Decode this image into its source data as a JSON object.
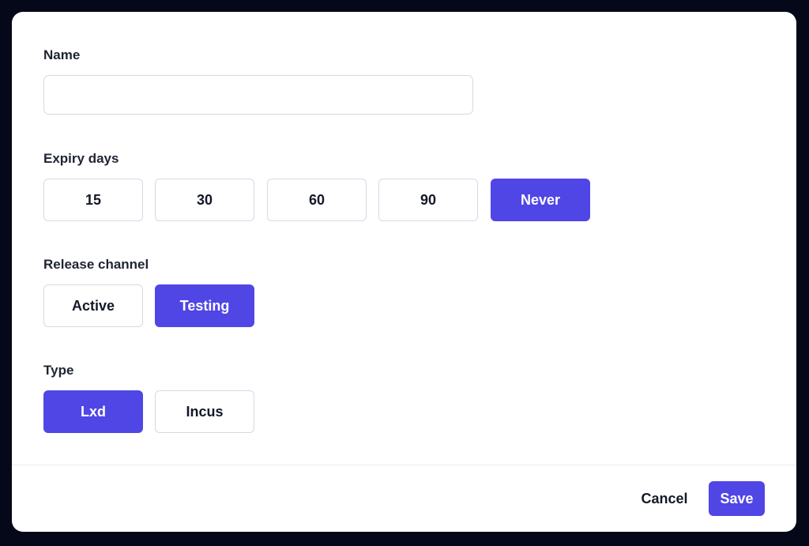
{
  "form": {
    "name": {
      "label": "Name",
      "value": "",
      "placeholder": ""
    },
    "expiry": {
      "label": "Expiry days",
      "options": [
        "15",
        "30",
        "60",
        "90",
        "Never"
      ],
      "selected": "Never"
    },
    "channel": {
      "label": "Release channel",
      "options": [
        "Active",
        "Testing"
      ],
      "selected": "Testing"
    },
    "type": {
      "label": "Type",
      "options": [
        "Lxd",
        "Incus"
      ],
      "selected": "Lxd"
    }
  },
  "footer": {
    "cancel_label": "Cancel",
    "save_label": "Save"
  },
  "colors": {
    "accent": "#4f46e5",
    "backdrop": "#050818"
  }
}
